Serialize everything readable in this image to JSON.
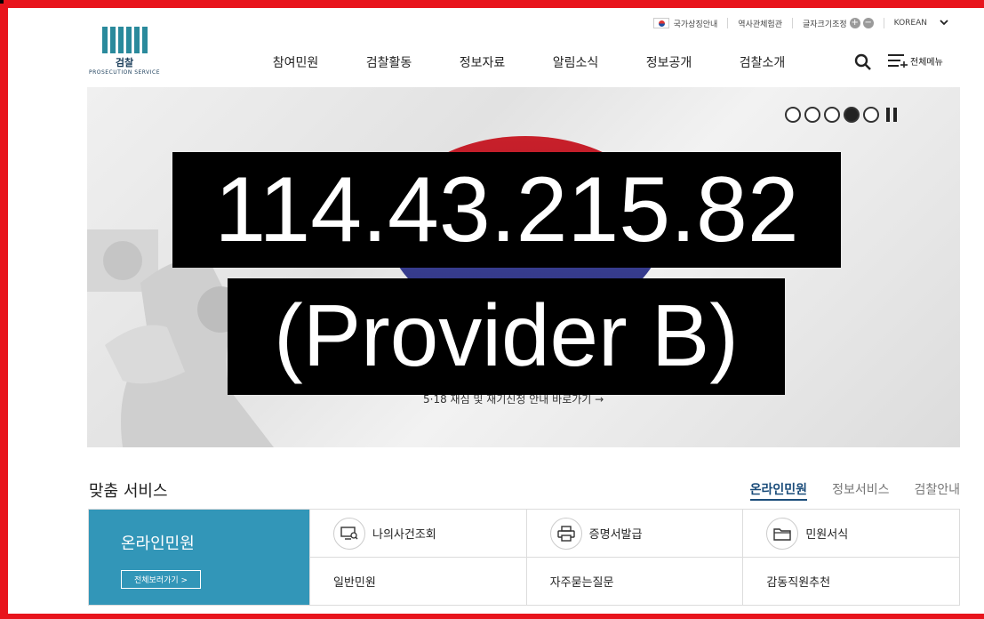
{
  "utility": {
    "portal": "국가상징안내",
    "history": "역사관체험관",
    "font_size": "글자크기조정",
    "plus": "+",
    "minus": "−",
    "language": "KOREAN"
  },
  "logo": {
    "ko": "검찰",
    "en": "PROSECUTION SERVICE"
  },
  "nav": [
    "참여민원",
    "검찰활동",
    "정보자료",
    "알림소식",
    "정보공개",
    "검찰소개"
  ],
  "all_menu": "전체메뉴",
  "hero": {
    "link": "5·18 재심 및 재기신청 안내 바로가기 →",
    "slides": 5,
    "active_slide": 4
  },
  "overlay": {
    "line1": "114.43.215.82",
    "line2": "(Provider B)"
  },
  "services": {
    "title": "맞춤 서비스",
    "tabs": [
      "온라인민원",
      "정보서비스",
      "검찰안내"
    ],
    "feature_title": "온라인민원",
    "feature_button": "전체보러가기  >",
    "cells": [
      "나의사건조회",
      "증명서발급",
      "민원서식",
      "일반민원",
      "자주묻는질문",
      "감동직원추천"
    ]
  },
  "colors": {
    "accent": "#3296b8",
    "frame": "#e8141c",
    "brand": "#2a8a9c"
  }
}
